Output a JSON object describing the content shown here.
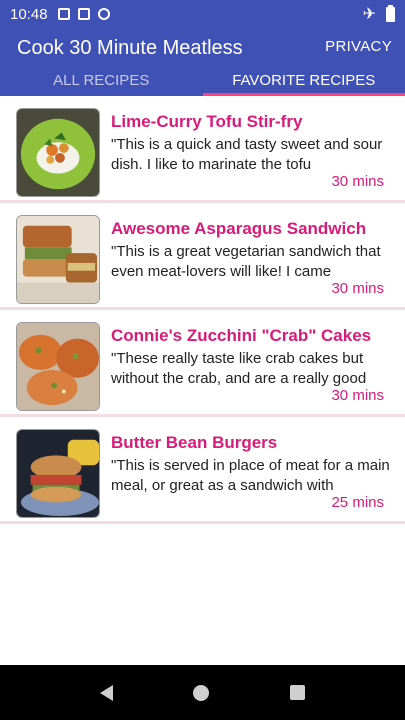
{
  "status": {
    "time": "10:48"
  },
  "app": {
    "title": "Cook 30 Minute Meatless",
    "privacy": "PRIVACY",
    "tabs": [
      "ALL RECIPES",
      "FAVORITE RECIPES"
    ],
    "active_tab": 1
  },
  "recipes": [
    {
      "title": "Lime-Curry Tofu Stir-fry",
      "desc": "\"This is a quick and tasty sweet and sour dish. I like to marinate the tofu",
      "time": "30 mins",
      "image": "stir-fry-photo"
    },
    {
      "title": "Awesome Asparagus Sandwich",
      "desc": "\"This is a great vegetarian sandwich that even meat-lovers will like! I came",
      "time": "30 mins",
      "image": "sandwich-photo"
    },
    {
      "title": "Connie's Zucchini \"Crab\" Cakes",
      "desc": "\"These really taste like crab cakes but without the crab, and are a really good",
      "time": "30 mins",
      "image": "crab-cakes-photo"
    },
    {
      "title": "Butter Bean Burgers",
      "desc": "\"This is served in place of meat for a main meal, or great as a sandwich with",
      "time": "25 mins",
      "image": "burger-photo"
    }
  ],
  "colors": {
    "primary": "#3f51b5",
    "accent": "#d81b78",
    "tab_indicator": "#ff4081"
  },
  "icons": {
    "back": "back-triangle-icon",
    "home": "home-circle-icon",
    "recents": "recents-square-icon"
  }
}
